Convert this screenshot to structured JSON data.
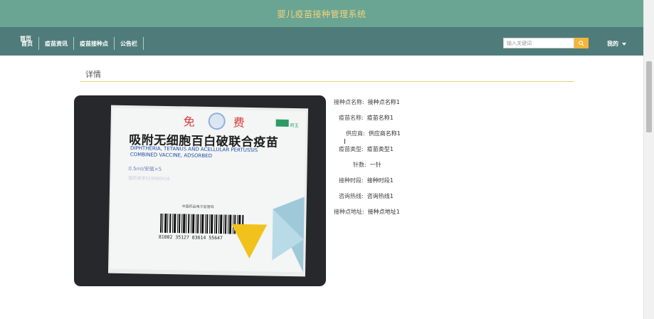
{
  "header": {
    "app_title": "婴儿疫苗接种管理系统"
  },
  "nav": {
    "home_overlay": "首页",
    "items": [
      {
        "label": "首页"
      },
      {
        "label": "疫苗资讯"
      },
      {
        "label": "疫苗接种点"
      },
      {
        "label": "公告栏"
      }
    ]
  },
  "search": {
    "placeholder": "输入关键词",
    "button_icon": "search-icon"
  },
  "user": {
    "label": "我的",
    "icon": "chevron-down-icon"
  },
  "detail": {
    "title": "详情",
    "image_text": {
      "free_left": "免",
      "free_right": "费",
      "brand": "药玉",
      "vaccine_cn": "吸附无细胞百白破联合疫苗",
      "vaccine_en_1": "DIPHTHERIA, TETANUS AND ACELLULAR PERTUSSIS",
      "vaccine_en_2": "COMBINED VACCINE, ADSORBED",
      "dose": "0.5ml/安瓿×5",
      "approval": "国药准字S19980016",
      "supervision": "中国药品电子监管码",
      "barcode_number": "81002 35127 83614 55647"
    },
    "fields": [
      {
        "label": "接种点名称:",
        "value": "接种点名称1"
      },
      {
        "label": "疫苗名称:",
        "value": "疫苗名称1"
      },
      {
        "label": "供应商:",
        "value": "供应商名称1"
      },
      {
        "label": "疫苗类型:",
        "value": "疫苗类型1"
      },
      {
        "label": "针数:",
        "value": "一针"
      },
      {
        "label": "接种时段:",
        "value": "接种时段1"
      },
      {
        "label": "咨询热线:",
        "value": "咨询热线1"
      },
      {
        "label": "接种点地址:",
        "value": "接种点地址1"
      }
    ]
  },
  "colors": {
    "topbar": "#6aa593",
    "navbar": "#4f7c7a",
    "title_gold": "#f3d37a",
    "search_button": "#f5b53a",
    "divider": "#e8cf7c"
  }
}
